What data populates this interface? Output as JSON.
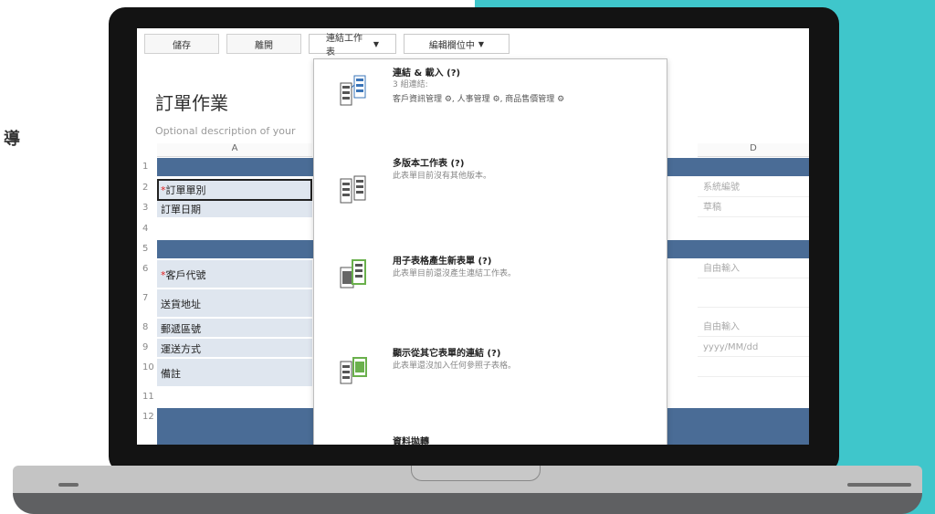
{
  "side_char": "導",
  "app": {
    "toolbar": {
      "save": "儲存",
      "close": "離開",
      "link_sheet": "連結工作表",
      "edit_field": "編輯欄位中"
    },
    "title": "訂單作業",
    "description": "Optional description of your",
    "columns": [
      "A",
      "D"
    ],
    "rows": [
      {
        "num": "1",
        "type": "band",
        "label": ""
      },
      {
        "num": "2",
        "type": "field",
        "label": "訂單單別",
        "required": true,
        "d": "系統編號"
      },
      {
        "num": "3",
        "type": "field",
        "label": "訂單日期",
        "required": false,
        "d": "草稿"
      },
      {
        "num": "4",
        "type": "blank",
        "label": ""
      },
      {
        "num": "5",
        "type": "band",
        "label": ""
      },
      {
        "num": "6",
        "type": "field",
        "label": "客戶代號",
        "required": true,
        "d": "自由輸入"
      },
      {
        "num": "7",
        "type": "field",
        "label": "送貨地址",
        "required": false,
        "d": ""
      },
      {
        "num": "8",
        "type": "field",
        "label": "郵遞區號",
        "required": false,
        "d": "自由輸入"
      },
      {
        "num": "9",
        "type": "field",
        "label": "運送方式",
        "required": false,
        "d": "yyyy/MM/dd"
      },
      {
        "num": "10",
        "type": "field",
        "label": "備註",
        "required": false,
        "d": ""
      },
      {
        "num": "11",
        "type": "blank",
        "label": ""
      },
      {
        "num": "12",
        "type": "band",
        "label": ""
      }
    ]
  },
  "menu": {
    "items": [
      {
        "title": "連結 & 載入 (?)",
        "line1": "3 組連結:",
        "links": "客戶資訊管理 ⚙, 人事管理 ⚙, 商品售價管理 ⚙"
      },
      {
        "title": "多版本工作表 (?)",
        "desc": "此表單目前沒有其他版本。"
      },
      {
        "title": "用子表格產生新表單 (?)",
        "desc": "此表單目前還沒產生連結工作表。"
      },
      {
        "title": "顯示從其它表單的連結 (?)",
        "desc": "此表單還沒加入任何參照子表格。"
      },
      {
        "title": "資料拋轉",
        "desc": ""
      }
    ]
  },
  "colors": {
    "teal": "#3fc6cb",
    "band": "#4a6c96",
    "field": "#dfe6ef",
    "icon_blue": "#3a74b8",
    "icon_green": "#6ab04c"
  }
}
